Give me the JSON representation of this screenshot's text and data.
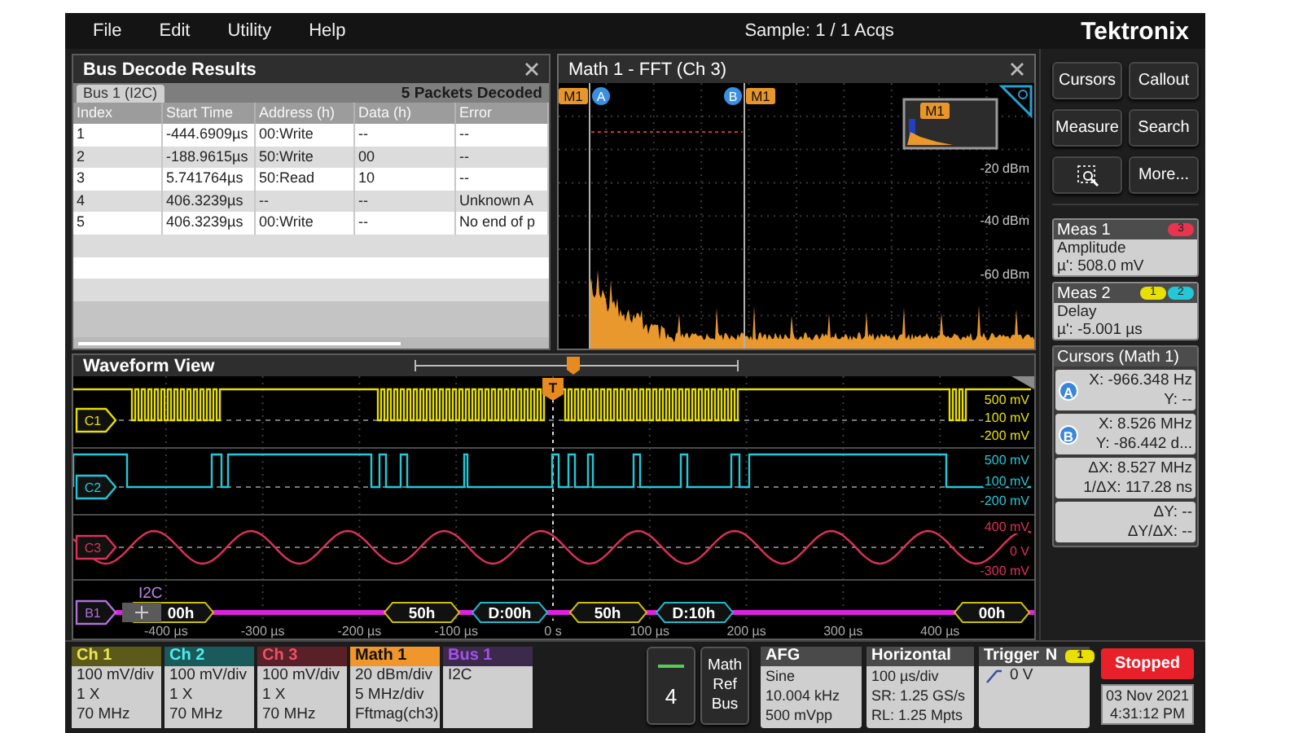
{
  "menu": [
    {
      "label": "File"
    },
    {
      "label": "Edit"
    },
    {
      "label": "Utility"
    },
    {
      "label": "Help"
    }
  ],
  "acquisition_status": "Sample: 1 / 1 Acqs",
  "brand": "Tektronix",
  "bus_decode": {
    "title": "Bus Decode Results",
    "tab": {
      "label": "Bus 1 (I2C)",
      "selected": true
    },
    "summary": "5 Packets Decoded",
    "columns": [
      "Index",
      "Start Time",
      "Address (h)",
      "Data (h)",
      "Error"
    ],
    "rows": [
      [
        "1",
        "-444.6909µs",
        "00:Write",
        "--",
        "--"
      ],
      [
        "2",
        "-188.9615µs",
        "50:Write",
        "00",
        "--"
      ],
      [
        "3",
        "5.741764µs",
        "50:Read",
        "10",
        "--"
      ],
      [
        "4",
        "406.3239µs",
        "--",
        "--",
        "Unknown A"
      ],
      [
        "5",
        "406.3239µs",
        "00:Write",
        "--",
        "No end of p"
      ]
    ]
  },
  "fft": {
    "title": "Math 1 - FFT (Ch 3)",
    "cursors": [
      {
        "label": "A",
        "trace": "M1"
      },
      {
        "label": "B",
        "trace": "M1"
      }
    ],
    "y_labels": [
      "-20 dBm",
      "-40 dBm",
      "-60 dBm"
    ],
    "overview_label": "M1"
  },
  "waveform_view": {
    "title": "Waveform View",
    "trigger_label": "T",
    "channels": [
      {
        "label": "C1",
        "kind": "clock",
        "color": "#e8e000",
        "scale": [
          "500 mV",
          "100 mV",
          "-200 mV"
        ]
      },
      {
        "label": "C2",
        "kind": "data",
        "color": "#22c8d8",
        "scale": [
          "500 mV",
          "100 mV",
          "-200 mV"
        ]
      },
      {
        "label": "C3",
        "kind": "sine",
        "color": "#e0305a",
        "scale": [
          "400 mV",
          "0 V",
          "-300 mV"
        ]
      }
    ],
    "bus": {
      "label": "B1",
      "protocol": "I2C",
      "color": "#e020e0",
      "packets": [
        {
          "text": "00h",
          "kind": "address"
        },
        {
          "text": "50h",
          "kind": "address"
        },
        {
          "text": "D:00h",
          "kind": "data"
        },
        {
          "text": "50h",
          "kind": "address"
        },
        {
          "text": "D:10h",
          "kind": "data"
        },
        {
          "text": "00h",
          "kind": "address"
        }
      ]
    },
    "time_labels": [
      "-400 µs",
      "-300 µs",
      "-200 µs",
      "-100 µs",
      "0 s",
      "100 µs",
      "200 µs",
      "300 µs",
      "400 µs"
    ]
  },
  "side_buttons": [
    {
      "kind": "text",
      "label": "Cursors"
    },
    {
      "kind": "text",
      "label": "Callout"
    },
    {
      "kind": "text",
      "label": "Measure"
    },
    {
      "kind": "text",
      "label": "Search"
    },
    {
      "kind": "zoom"
    },
    {
      "kind": "text",
      "label": "More..."
    }
  ],
  "measurements": [
    {
      "title": "Meas 1",
      "name": "Amplitude",
      "value": "µ': 508.0 mV",
      "badges": [
        {
          "text": "3",
          "color": "#e8344e"
        }
      ]
    },
    {
      "title": "Meas 2",
      "name": "Delay",
      "value": "µ': -5.001 µs",
      "badges": [
        {
          "text": "1",
          "color": "#e8e000"
        },
        {
          "text": "2",
          "color": "#22c8d8"
        }
      ]
    }
  ],
  "cursor_readouts": {
    "title": "Cursors (Math 1)",
    "readouts": [
      {
        "marker": "A",
        "lines": [
          "X: -966.348 Hz",
          "Y: --"
        ]
      },
      {
        "marker": "B",
        "lines": [
          "X: 8.526 MHz",
          "Y: -86.442 d..."
        ]
      },
      {
        "lines": [
          "ΔX: 8.527 MHz",
          "1/ΔX: 117.28 ns"
        ]
      },
      {
        "lines": [
          "ΔY: --",
          "ΔY/ΔX: --"
        ]
      }
    ]
  },
  "channel_badges": [
    {
      "title": "Ch 1",
      "kind": "channel",
      "color": "#5c5a1a",
      "lines": [
        "100 mV/div",
        "1 X",
        "70 MHz"
      ]
    },
    {
      "title": "Ch 2",
      "kind": "channel",
      "color": "#1a5a5a",
      "lines": [
        "100 mV/div",
        "1 X",
        "70 MHz"
      ]
    },
    {
      "title": "Ch 3",
      "kind": "channel",
      "color": "#5a2028",
      "lines": [
        "100 mV/div",
        "1 X",
        "70 MHz"
      ]
    },
    {
      "title": "Math 1",
      "kind": "math",
      "color": "#f0962a",
      "lines": [
        "20 dBm/div",
        "5 MHz/div",
        "Fftmag(ch3)"
      ]
    },
    {
      "title": "Bus 1",
      "kind": "bus",
      "color": "#3c2a4c",
      "lines": [
        "I2C"
      ]
    }
  ],
  "channel_4_button": {
    "label": "4"
  },
  "add_waveform_button": {
    "label": "Math Ref Bus"
  },
  "settings": [
    {
      "title": "AFG",
      "lines": [
        "Sine",
        "10.004 kHz",
        "500 mVpp"
      ]
    },
    {
      "title": "Horizontal",
      "lines": [
        "100 µs/div",
        "SR: 1.25 GS/s",
        "RL: 1.25 Mpts"
      ]
    }
  ],
  "trigger": {
    "title": "Trigger",
    "mode": "N",
    "source": {
      "text": "1",
      "color": "#e8e000"
    },
    "threshold": "0 V"
  },
  "run_state": {
    "label": "Stopped",
    "running": false
  },
  "date": "03 Nov 2021",
  "time": "4:31:12 PM"
}
